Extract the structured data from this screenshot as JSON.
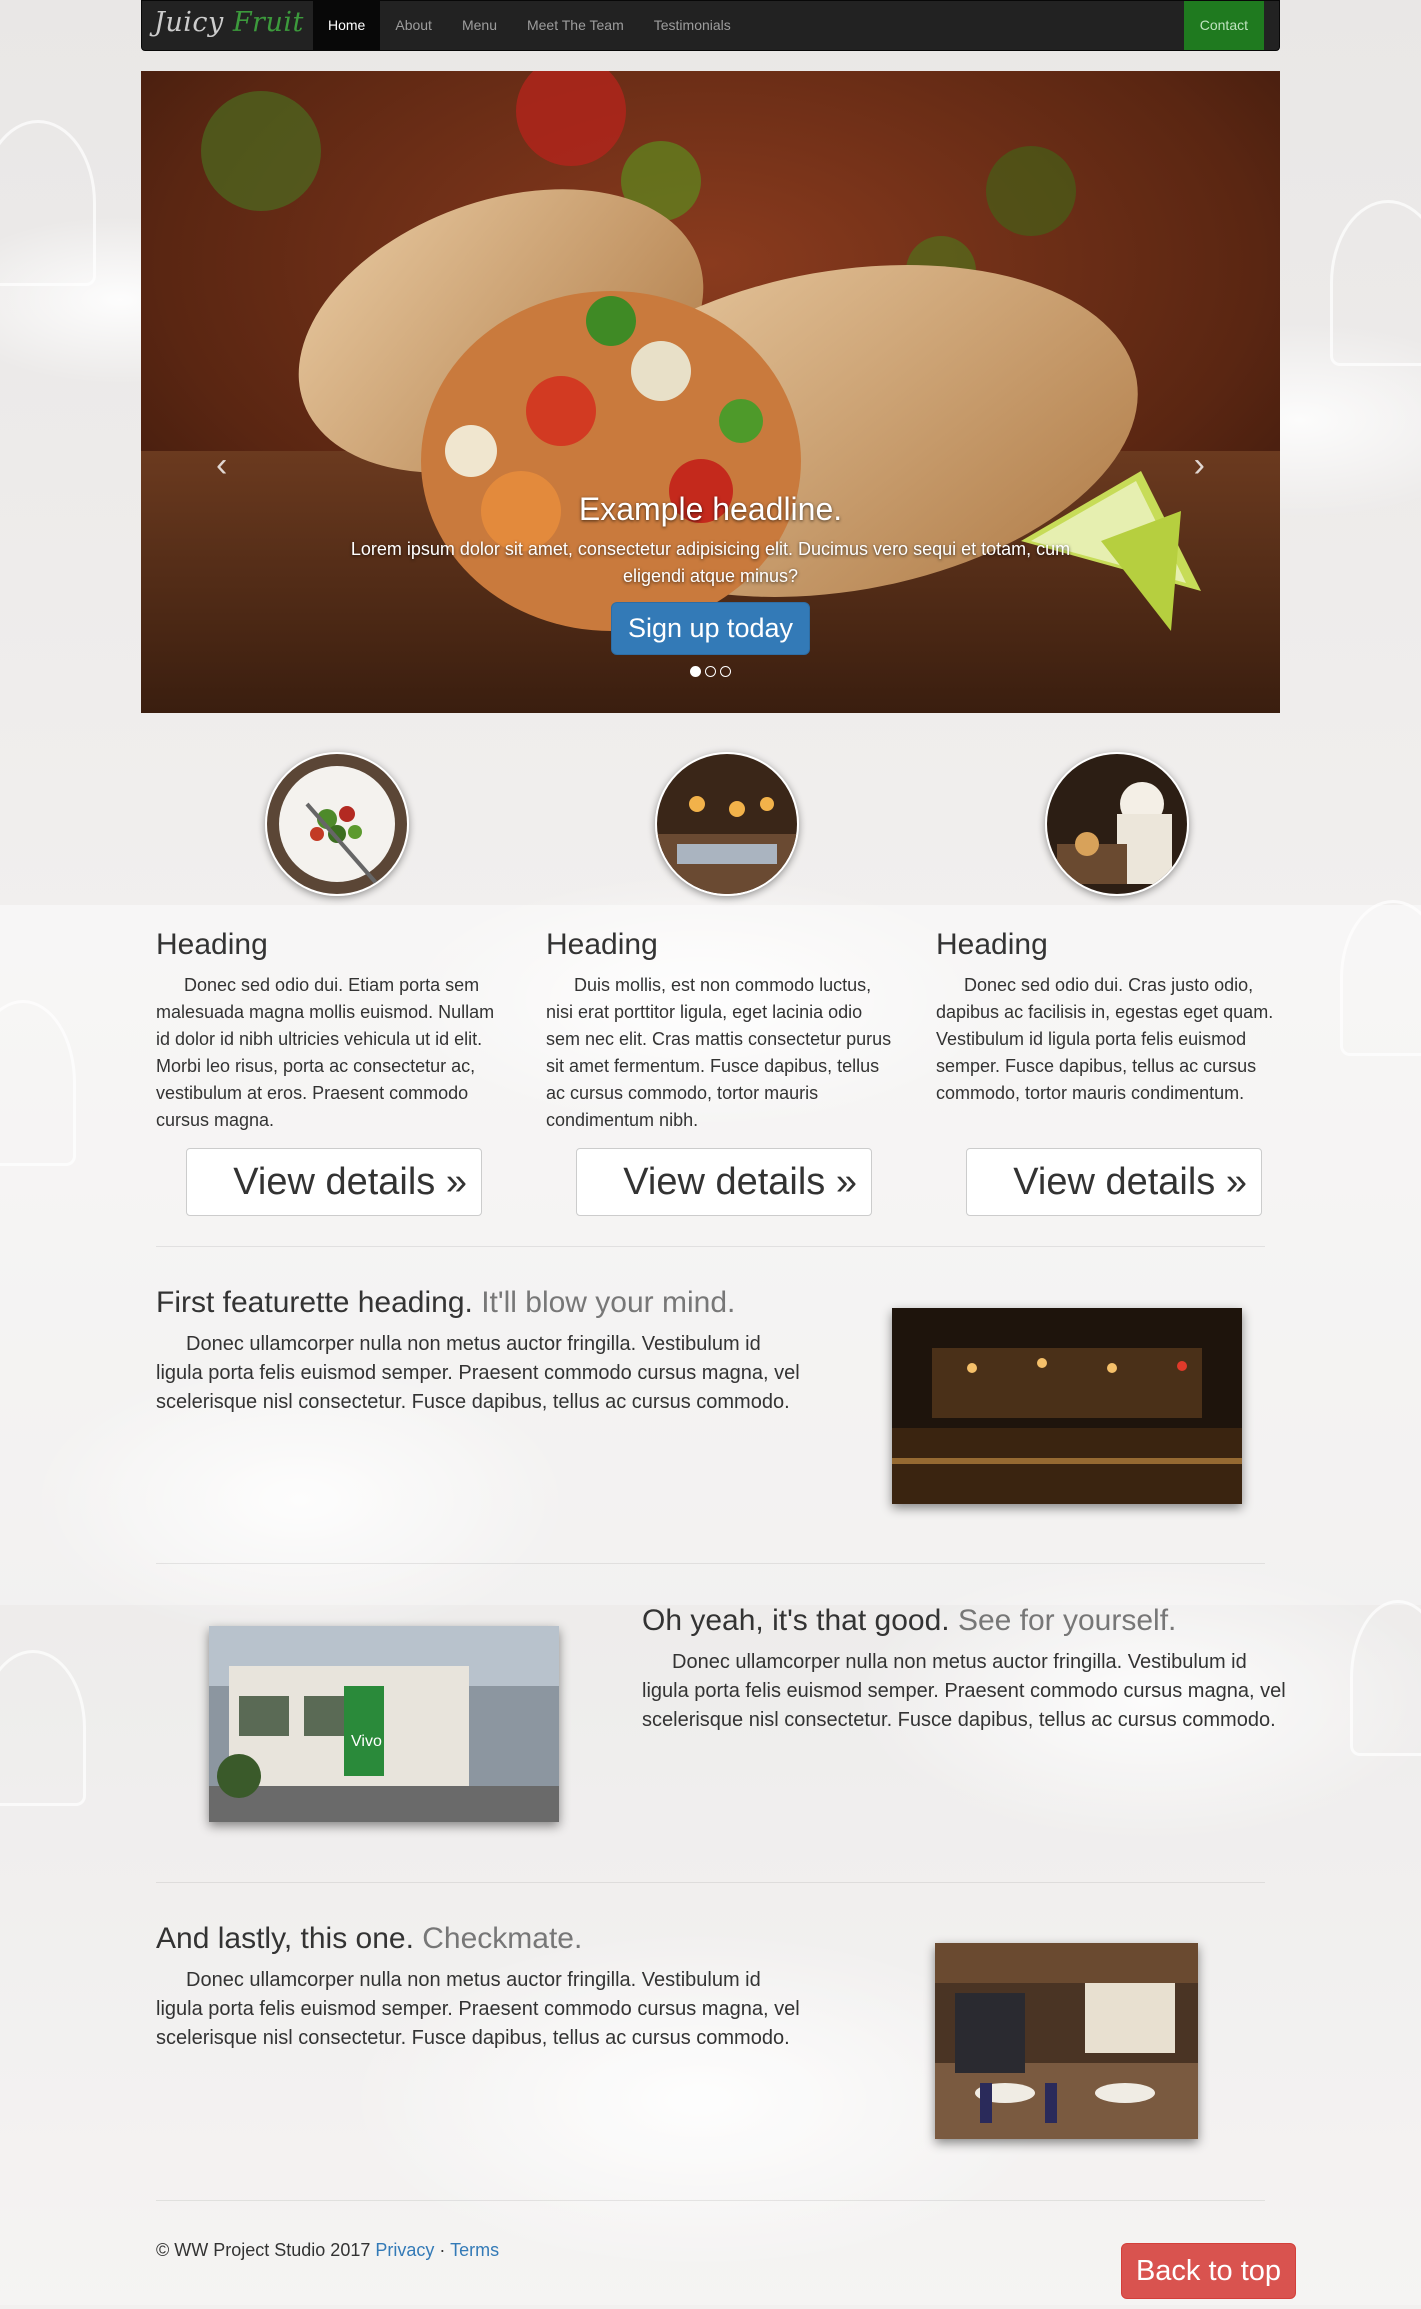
{
  "navbar": {
    "brand_part1": "Juicy",
    "brand_part2": "Fruit",
    "items": [
      {
        "label": "Home",
        "active": true
      },
      {
        "label": "About"
      },
      {
        "label": "Menu"
      },
      {
        "label": "Meet The Team"
      },
      {
        "label": "Testimonials"
      }
    ],
    "contact": "Contact"
  },
  "carousel": {
    "headline": "Example headline.",
    "text": "Lorem ipsum dolor sit amet, consectetur adipisicing elit. Ducimus vero sequi et totam, cum eligendi atque minus?",
    "button": "Sign up today",
    "prev": "‹",
    "next": "›",
    "active_slide": 1,
    "slide_count": 3
  },
  "marketing": [
    {
      "heading": "Heading",
      "text": "Donec sed odio dui. Etiam porta sem malesuada magna mollis euismod. Nullam id dolor id nibh ultricies vehicula ut id elit. Morbi leo risus, porta ac consectetur ac, vestibulum at eros. Praesent commodo cursus magna.",
      "button": "View details »"
    },
    {
      "heading": "Heading",
      "text": "Duis mollis, est non commodo luctus, nisi erat porttitor ligula, eget lacinia odio sem nec elit. Cras mattis consectetur purus sit amet fermentum. Fusce dapibus, tellus ac cursus commodo, tortor mauris condimentum nibh.",
      "button": "View details »"
    },
    {
      "heading": "Heading",
      "text": "Donec sed odio dui. Cras justo odio, dapibus ac facilisis in, egestas eget quam. Vestibulum id ligula porta felis euismod semper. Fusce dapibus, tellus ac cursus commodo, tortor mauris condimentum.",
      "button": "View details »"
    }
  ],
  "featurettes": [
    {
      "heading": "First featurette heading.",
      "muted": "It'll blow your mind.",
      "text": "Donec ullamcorper nulla non metus auctor fringilla. Vestibulum id ligula porta felis euismod semper. Praesent commodo cursus magna, vel scelerisque nisl consectetur. Fusce dapibus, tellus ac cursus commodo."
    },
    {
      "heading": "Oh yeah, it's that good.",
      "muted": "See for yourself.",
      "text": "Donec ullamcorper nulla non metus auctor fringilla. Vestibulum id ligula porta felis euismod semper. Praesent commodo cursus magna, vel scelerisque nisl consectetur. Fusce dapibus, tellus ac cursus commodo."
    },
    {
      "heading": "And lastly, this one.",
      "muted": "Checkmate.",
      "text": "Donec ullamcorper nulla non metus auctor fringilla. Vestibulum id ligula porta felis euismod semper. Praesent commodo cursus magna, vel scelerisque nisl consectetur. Fusce dapibus, tellus ac cursus commodo."
    }
  ],
  "storefront_sign": "Vivo",
  "footer": {
    "copyright": "© WW Project Studio 2017",
    "privacy": "Privacy",
    "separator": "·",
    "terms": "Terms",
    "back_to_top": "Back to top"
  }
}
